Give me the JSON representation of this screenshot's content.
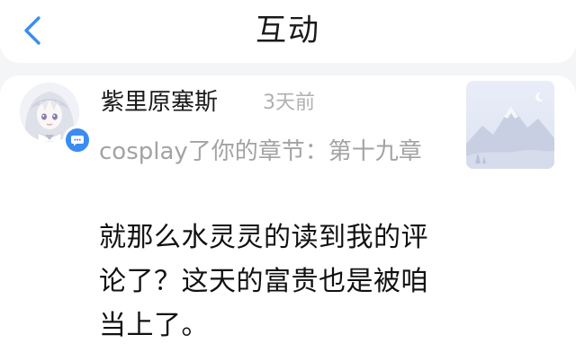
{
  "header": {
    "title": "互动",
    "back_icon": "chevron-left-icon",
    "accent_color": "#3b8cf0"
  },
  "notification": {
    "username": "紫里原塞斯",
    "time": "3天前",
    "action": "cosplay了你的章节：第十九章",
    "comment": "就那么水灵灵的读到我的评论了？这天的富贵也是被咱当上了。",
    "avatar_icon": "anime-avatar",
    "badge_icon": "comment-icon",
    "thumbnail_icon": "placeholder-mountain-image"
  }
}
